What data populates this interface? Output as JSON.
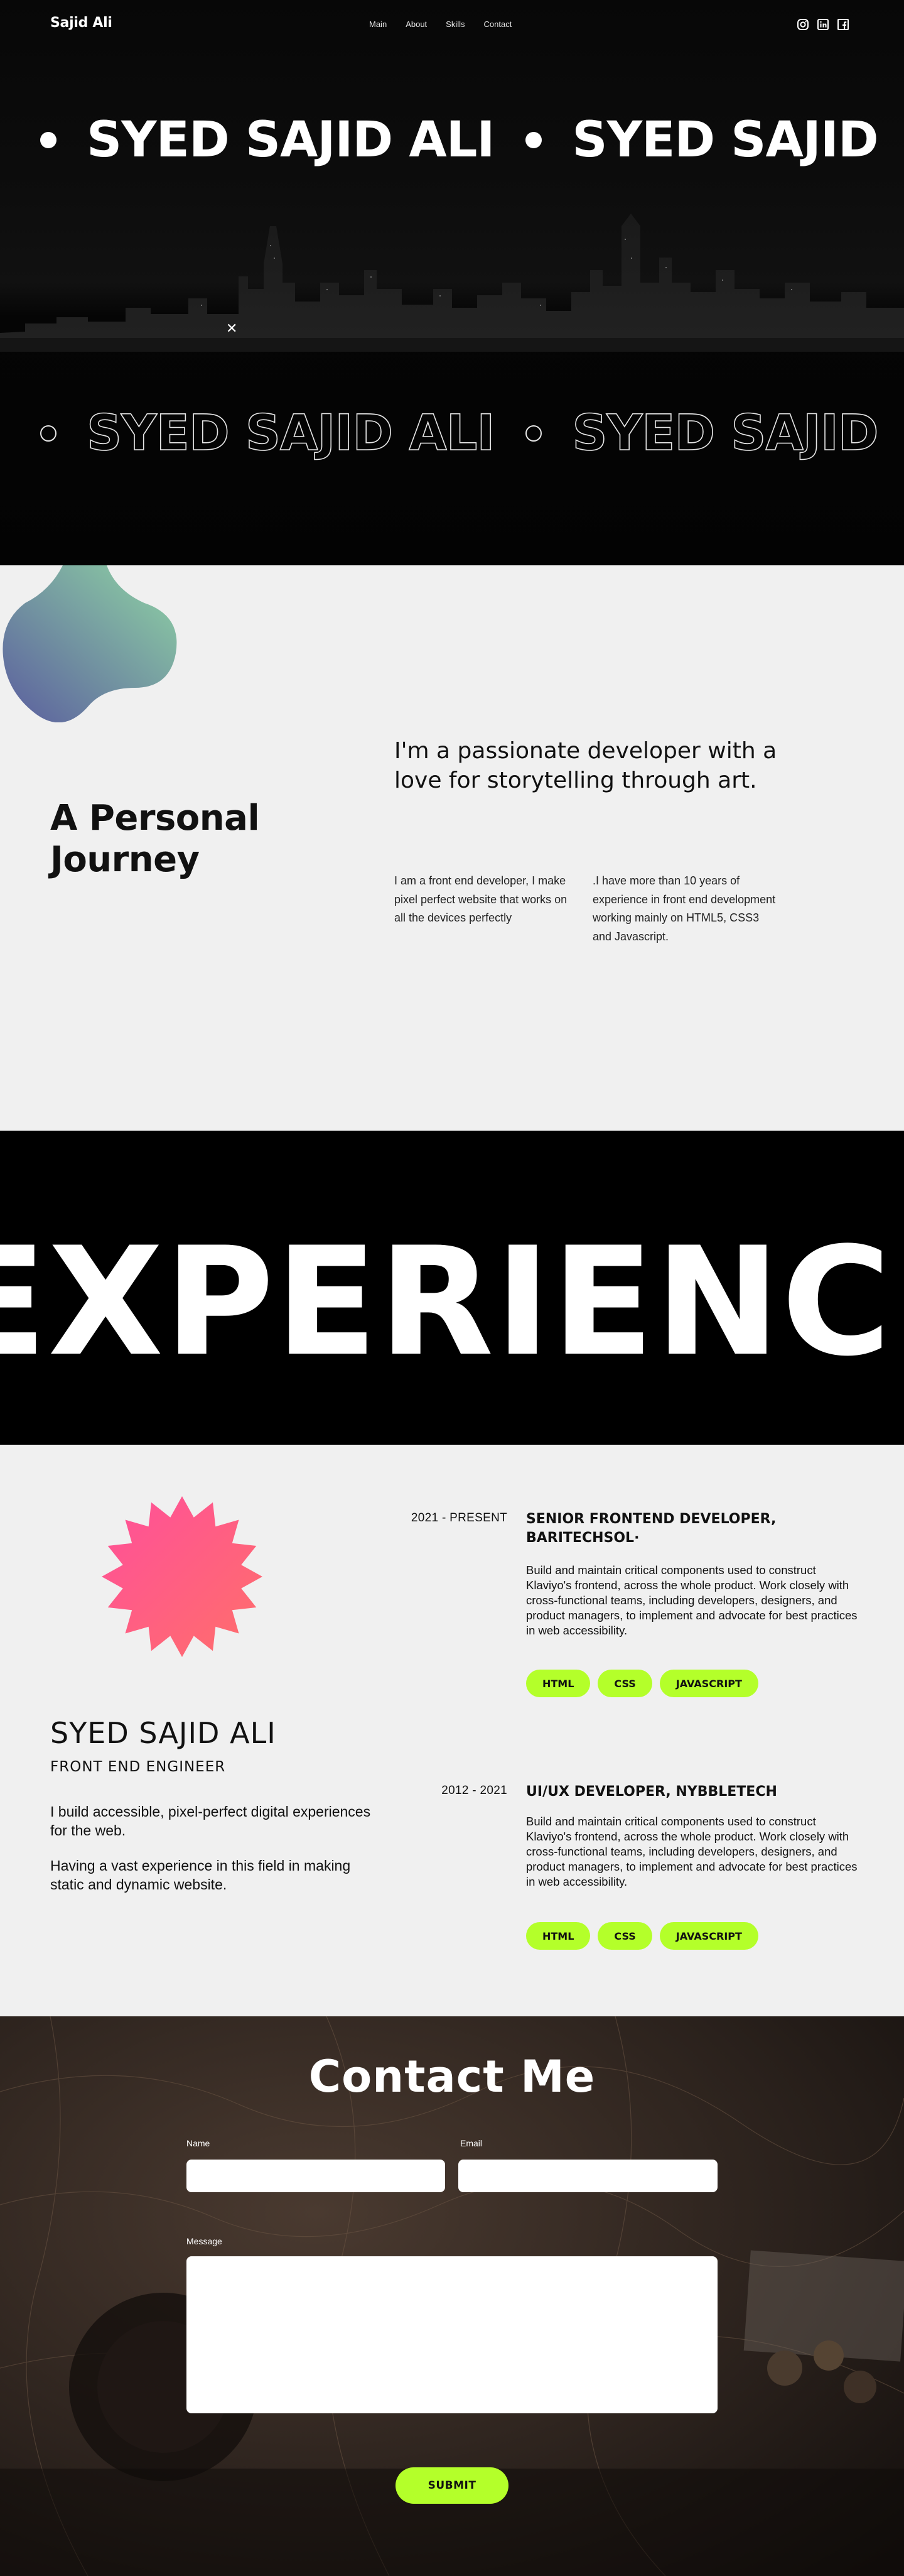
{
  "nav": {
    "brand": "Sajid Ali",
    "links": [
      "Main",
      "About",
      "Skills",
      "Contact"
    ],
    "social_icons": [
      "instagram-icon",
      "linkedin-icon",
      "facebook-icon"
    ]
  },
  "hero": {
    "marquee_text": "SYED SAJID ALI",
    "marquee_text_repeat": "SYED SAJID"
  },
  "journey": {
    "title": "A Personal Journey",
    "lead": "I'm a passionate developer with a love for storytelling through art.",
    "col_a": "I am a front end developer, I make pixel perfect website that works on all the devices perfectly",
    "col_b": ".I have more than 10 years of experience in front end development working mainly on HTML5, CSS3 and Javascript."
  },
  "banner": {
    "word": "EXPERIENCE"
  },
  "profile": {
    "name": "SYED SAJID ALI",
    "role": "FRONT END ENGINEER",
    "text_1": "I build accessible, pixel-perfect digital experiences for the web.",
    "text_2": "Having a vast experience in this field in making static and dynamic website."
  },
  "jobs": [
    {
      "date": "2021 - PRESENT",
      "title": "SENIOR FRONTEND DEVELOPER, BARITECHSOL·",
      "description": "Build and maintain critical components used to construct Klaviyo's frontend, across the whole product. Work closely with cross-functional teams, including developers, designers, and product managers, to implement and advocate for best practices in web accessibility.",
      "tags": [
        "HTML",
        "CSS",
        "JAVASCRIPT"
      ]
    },
    {
      "date": "2012 - 2021",
      "title": "UI/UX DEVELOPER, NYBBLETECH",
      "description": "Build and maintain critical components used to construct Klaviyo's frontend, across the whole product. Work closely with cross-functional teams, including developers, designers, and product managers, to implement and advocate for best practices in web accessibility.",
      "tags": [
        "HTML",
        "CSS",
        "JAVASCRIPT"
      ]
    }
  ],
  "contact": {
    "title": "Contact Me",
    "name_label": "Name",
    "email_label": "Email",
    "message_label": "Message",
    "name_value": "",
    "email_value": "",
    "message_value": "",
    "submit_label": "SUBMIT"
  },
  "colors": {
    "accent": "#b4ff2a",
    "hero_bg": "#0a0a0a",
    "section_bg": "#f0f0f0",
    "star_gradient": [
      "#ff4f9a",
      "#ff6f6a"
    ],
    "blob_gradient": [
      "#5a5d9e",
      "#8fd4a4"
    ]
  }
}
